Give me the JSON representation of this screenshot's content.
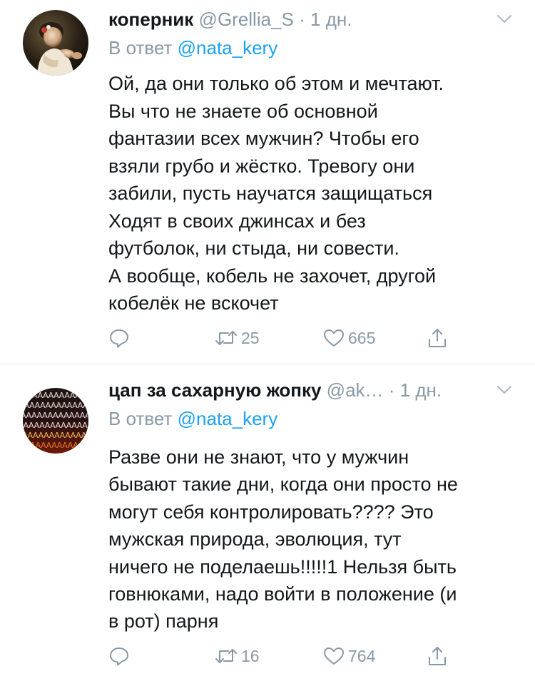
{
  "tweets": [
    {
      "author_name": "коперник",
      "handle": "@Grellia_S",
      "separator": "·",
      "time": "1 дн.",
      "reply_label": "В ответ",
      "reply_mention": "@nata_kery",
      "text_lines": [
        "Ой, да они только об этом и мечтают.",
        "Вы что не знаете об основной",
        "фантазии всех мужчин? Чтобы его",
        "взяли грубо и жёстко. Тревогу они",
        "забили, пусть научатся защищаться",
        "Ходят в своих джинсах и без",
        "футболок, ни стыда, ни совести.",
        "А вообще, кобель не захочет, другой",
        "кобелёк не вскочет"
      ],
      "replies": "",
      "retweets": "25",
      "likes": "665",
      "avatar_icon": "painting-portrait-avatar"
    },
    {
      "author_name": "цап за сахарную жопку",
      "handle": "@ak…",
      "separator": "·",
      "time": "1 дн.",
      "reply_label": "В ответ",
      "reply_mention": "@nata_kery",
      "text_lines": [
        "Разве они не знают, что у мужчин",
        "бывают такие дни, когда они просто не",
        "могут себя контролировать???? Это",
        "мужская природа, эволюция, тут",
        "ничего не поделаешь!!!!!1 Нельзя быть",
        "говнюками, надо войти в положение (и",
        "в рот) парня"
      ],
      "replies": "",
      "retweets": "16",
      "likes": "764",
      "avatar_icon": "text-pattern-avatar"
    }
  ],
  "avatar2_pattern_text": "ААААААААААААААААААААААААААААААААААААААА",
  "colors": {
    "text": "#14171a",
    "secondary": "#8899a6",
    "link": "#1da1f2",
    "divider": "#e1e8ed"
  }
}
